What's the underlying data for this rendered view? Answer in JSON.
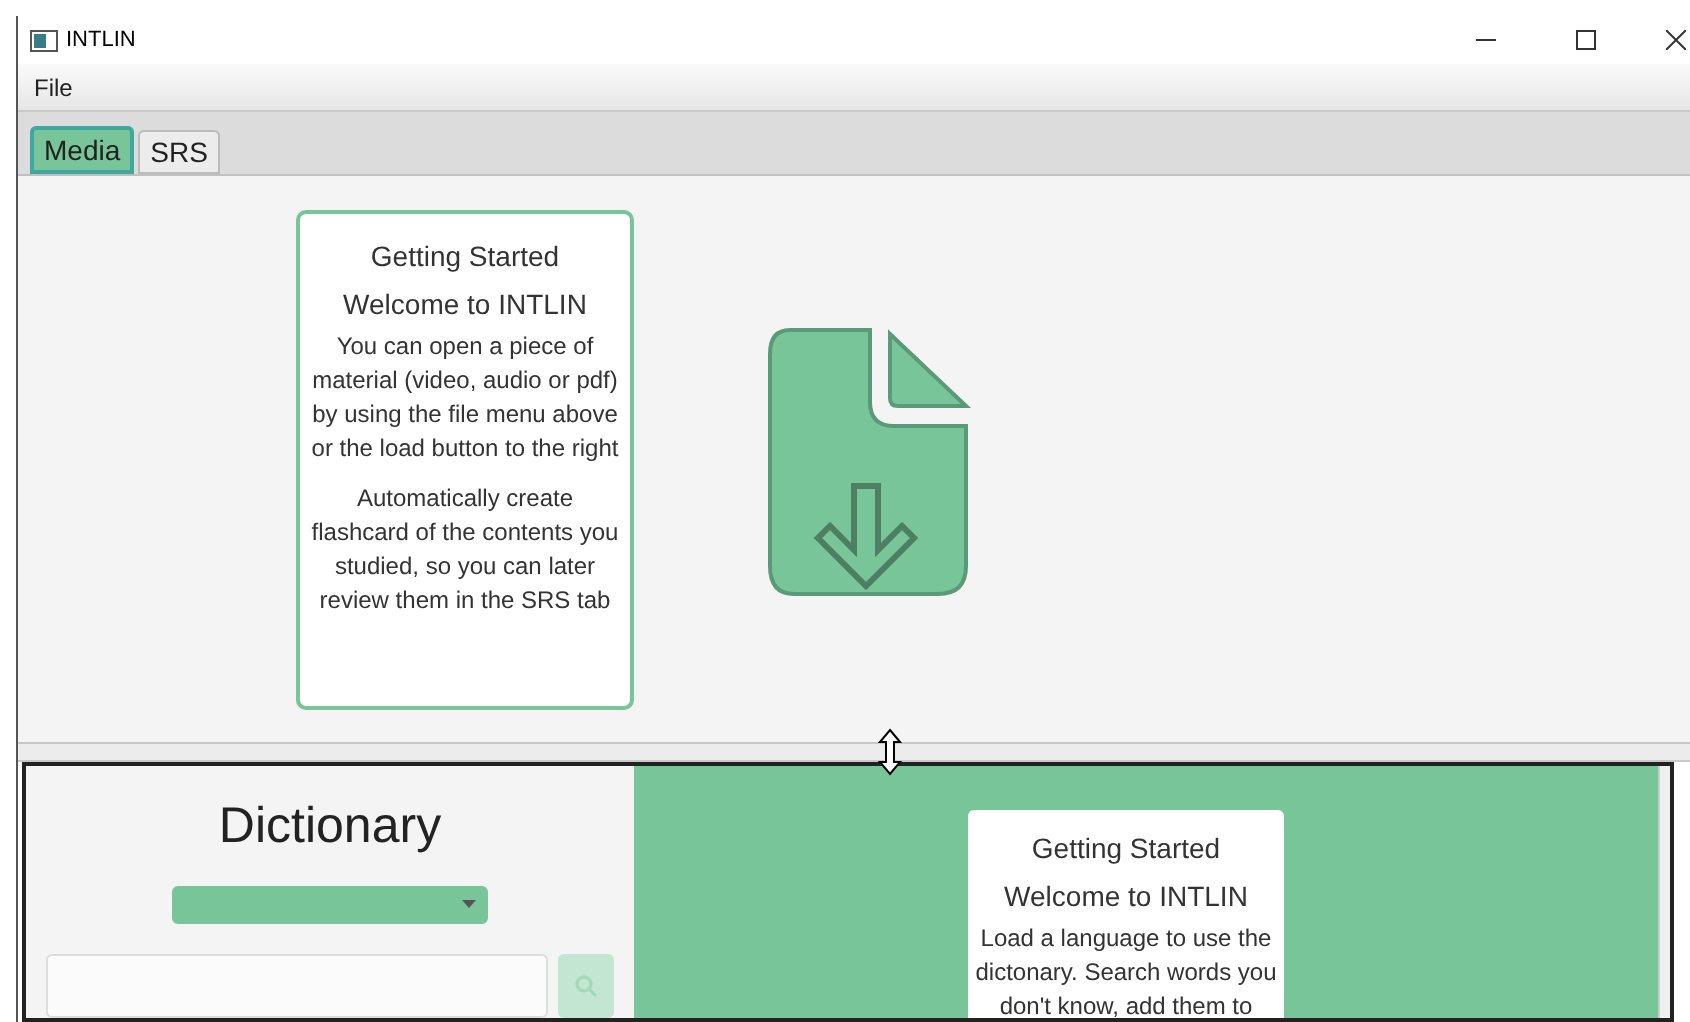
{
  "window": {
    "title": "INTLIN"
  },
  "menu": [
    "File"
  ],
  "tabs": [
    {
      "label": "Media",
      "selected": true
    },
    {
      "label": "SRS",
      "selected": false
    }
  ],
  "media_card": {
    "title": "Getting Started",
    "subtitle": "Welcome to INTLIN",
    "paragraphs": [
      "You can open a piece of material (video, audio or pdf) by using the file menu above or the load button to the right",
      "Automatically create flashcard of the contents you studied, so you can later review them in the SRS tab"
    ]
  },
  "dictionary": {
    "title": "Dictionary",
    "search_button_disabled": true
  },
  "dictionary_card": {
    "title": "Getting Started",
    "subtitle": "Welcome to INTLIN",
    "paragraphs": [
      "Load a language to use the dictonary. Search words you don't know, add them to"
    ]
  }
}
